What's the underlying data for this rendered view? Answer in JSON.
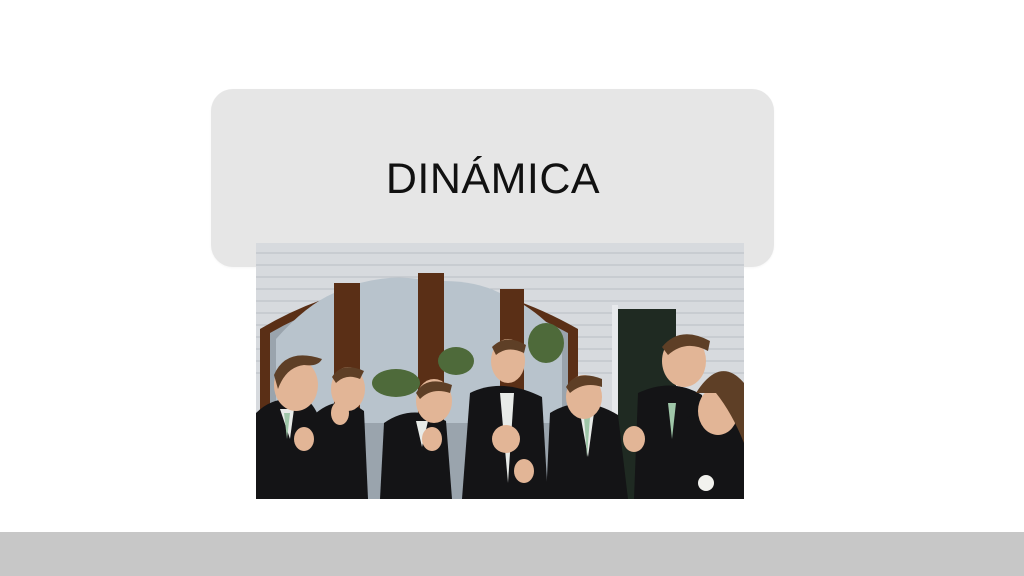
{
  "slide": {
    "title": "DINÁMICA"
  },
  "colors": {
    "background": "#ffffff",
    "title_box": "#e6e6e6",
    "footer": "#c7c7c7",
    "title_text": "#111111"
  },
  "photo": {
    "subject": "groomsmen-reacting-to-ring"
  }
}
